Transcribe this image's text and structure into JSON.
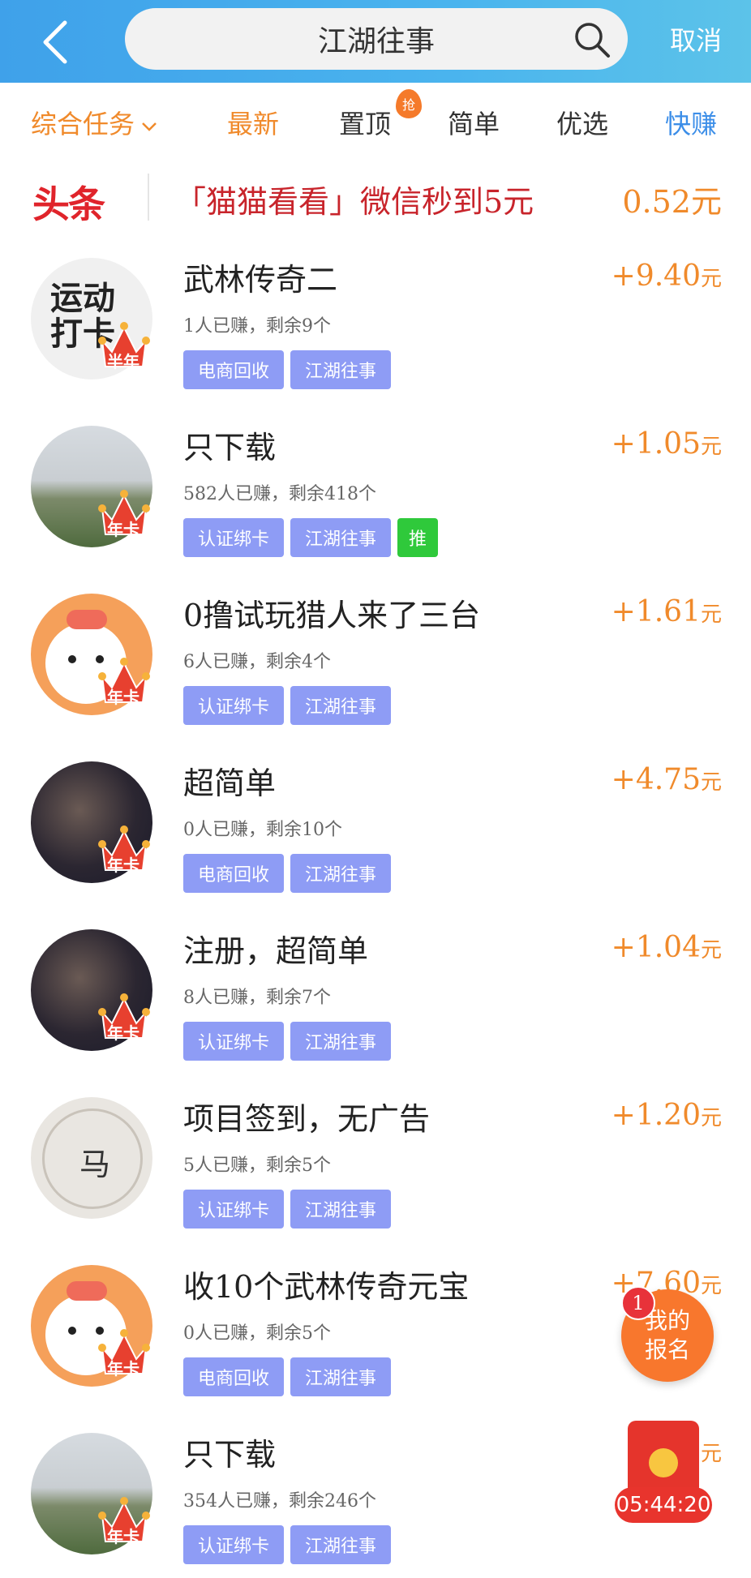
{
  "header": {
    "search_value": "江湖往事",
    "cancel_label": "取消",
    "bg_color": "#3fa1ea"
  },
  "tabs": [
    {
      "label": "综合任务"
    },
    {
      "label": "最新"
    },
    {
      "label": "置顶"
    },
    {
      "label": "简单"
    },
    {
      "label": "优选"
    },
    {
      "label": "快赚"
    }
  ],
  "hot_badge": "抢",
  "headline": {
    "logo": "头条",
    "text": "「猫猫看看」微信秒到5元",
    "price": "0.52元"
  },
  "items": [
    {
      "title": "武林传奇二",
      "stats": "1人已赚，剩余9个",
      "price": "+9.40",
      "unit": "元",
      "crown": "半年",
      "tags": [
        "电商回收",
        "江湖往事"
      ],
      "avatar_text": [
        "运动",
        "打卡"
      ]
    },
    {
      "title": "只下载",
      "stats": "582人已赚，剩余418个",
      "price": "+1.05",
      "unit": "元",
      "crown": "年卡",
      "tags": [
        "认证绑卡",
        "江湖往事"
      ],
      "extra_tag": "推"
    },
    {
      "title": "0撸试玩猎人来了三台",
      "stats": "6人已赚，剩余4个",
      "price": "+1.61",
      "unit": "元",
      "crown": "年卡",
      "tags": [
        "认证绑卡",
        "江湖往事"
      ]
    },
    {
      "title": "超简单",
      "stats": "0人已赚，剩余10个",
      "price": "+4.75",
      "unit": "元",
      "crown": "年卡",
      "tags": [
        "电商回收",
        "江湖往事"
      ]
    },
    {
      "title": "注册，超简单",
      "stats": "8人已赚，剩余7个",
      "price": "+1.04",
      "unit": "元",
      "crown": "年卡",
      "tags": [
        "认证绑卡",
        "江湖往事"
      ]
    },
    {
      "title": "项目签到，无广告",
      "stats": "5人已赚，剩余5个",
      "price": "+1.20",
      "unit": "元",
      "crown": "",
      "tags": [
        "认证绑卡",
        "江湖往事"
      ],
      "avatar_text": "马"
    },
    {
      "title": "收10个武林传奇元宝",
      "stats": "0人已赚，剩余5个",
      "price": "+7.60",
      "unit": "元",
      "crown": "年卡",
      "tags": [
        "电商回收",
        "江湖往事"
      ]
    },
    {
      "title": "只下载",
      "stats": "354人已赚，剩余246个",
      "price": "",
      "unit": "元",
      "crown": "年卡",
      "tags": [
        "认证绑卡",
        "江湖往事"
      ]
    }
  ],
  "float": {
    "count": "1",
    "line1": "我的",
    "line2": "报名",
    "timer": "05:44:20"
  }
}
